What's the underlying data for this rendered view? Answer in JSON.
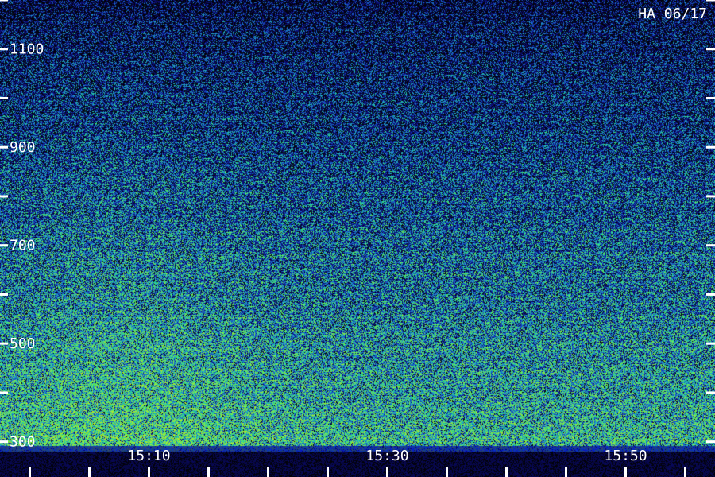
{
  "chart_data": {
    "type": "heatmap",
    "title": "HA 06/17",
    "y_axis": {
      "tick_labels": [
        "1100",
        "900",
        "700",
        "500",
        "300"
      ],
      "tick_values": [
        1100,
        900,
        700,
        500,
        300
      ],
      "minor_tick_values": [
        1200,
        1000,
        800,
        600,
        400
      ],
      "range": [
        1200,
        280
      ]
    },
    "x_axis": {
      "tick_labels": [
        "15:10",
        "15:30",
        "15:50"
      ],
      "tick_values_min": [
        910,
        930,
        950
      ],
      "minor_tick_values_min": [
        900,
        905,
        915,
        920,
        925,
        935,
        940,
        945,
        955,
        960
      ],
      "range_min": [
        897.5,
        957.5
      ]
    },
    "colors": {
      "low": "#0a0a60",
      "mid": "#1f63d8",
      "high": "#3fe08a",
      "peak": "#8cff50",
      "text": "#ffffff"
    }
  }
}
